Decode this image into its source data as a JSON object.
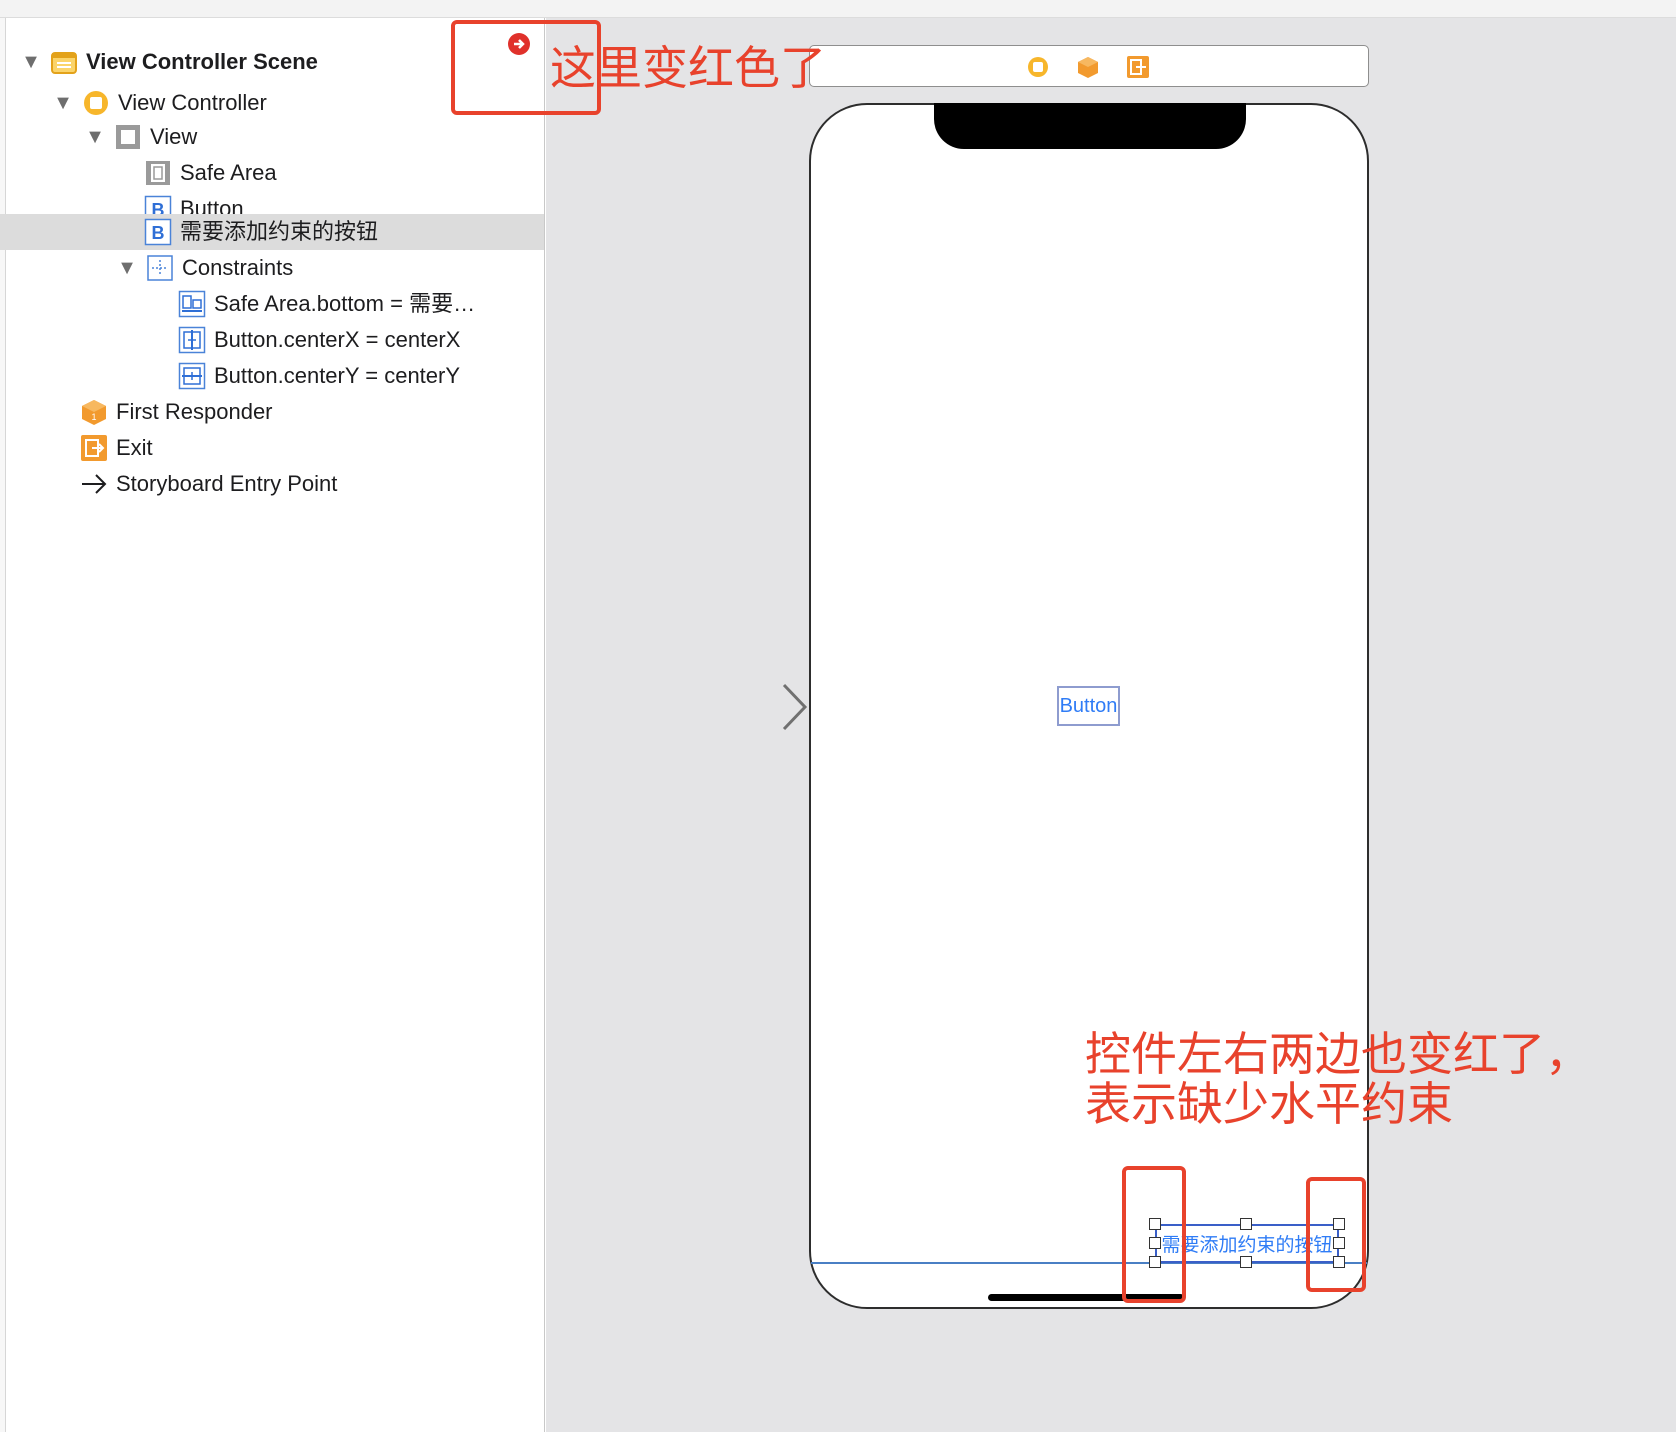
{
  "outline": {
    "items": [
      {
        "label": "View Controller Scene",
        "icon": "scene-icon"
      },
      {
        "label": "View Controller",
        "icon": "view-controller-icon"
      },
      {
        "label": "View",
        "icon": "view-icon"
      },
      {
        "label": "Safe Area",
        "icon": "safe-area-icon"
      },
      {
        "label": "Button",
        "icon": "button-icon"
      },
      {
        "label": "需要添加约束的按钮",
        "icon": "button-icon",
        "selected": true
      },
      {
        "label": "Constraints",
        "icon": "constraints-icon"
      },
      {
        "label": "Safe Area.bottom = 需要…",
        "icon": "constraint-bottom-icon"
      },
      {
        "label": "Button.centerX = centerX",
        "icon": "constraint-centerx-icon"
      },
      {
        "label": "Button.centerY = centerY",
        "icon": "constraint-centery-icon"
      },
      {
        "label": "First Responder",
        "icon": "first-responder-icon"
      },
      {
        "label": "Exit",
        "icon": "exit-icon"
      },
      {
        "label": "Storyboard Entry Point",
        "icon": "entry-point-arrow-icon"
      }
    ],
    "button_glyph": "B"
  },
  "canvas": {
    "center_button_label": "Button",
    "bottom_button_label": "需要添加约束的按钮"
  },
  "annotations": {
    "top_note": "这里变红色了",
    "bottom_note_line1": "控件左右两边也变红了，",
    "bottom_note_line2": "表示缺少水平约束"
  },
  "colors": {
    "annotation_red": "#e8422c",
    "selection_gray": "#dcdcdc",
    "canvas_bg": "#e4e4e6",
    "link_blue": "#2f7cf6",
    "icon_orange": "#f5a623"
  }
}
